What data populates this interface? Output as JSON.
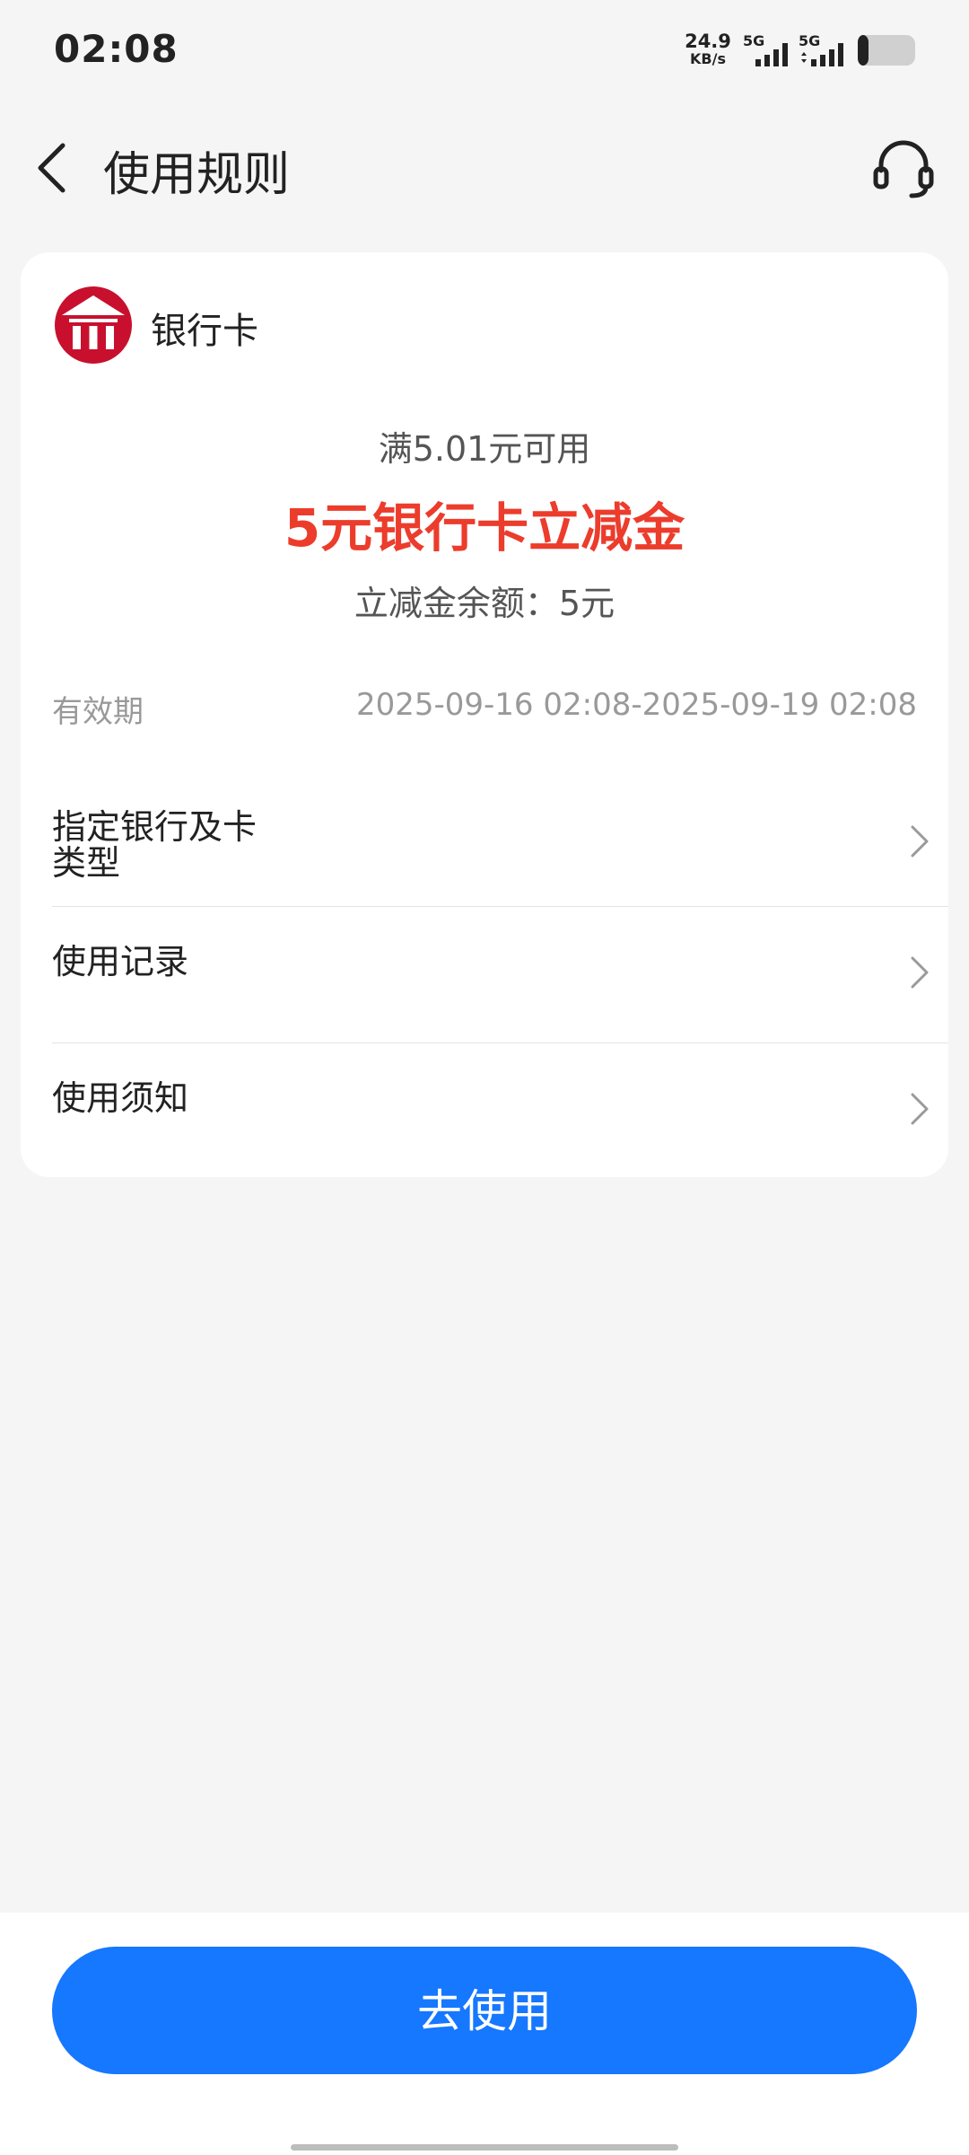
{
  "status_bar": {
    "time": "02:08",
    "net_speed_value": "24.9",
    "net_speed_unit": "KB/s",
    "sim1_label": "5G",
    "sim2_label": "5G",
    "battery_icon": "battery-icon"
  },
  "header": {
    "title": "使用规则",
    "back_icon": "back-arrow-icon",
    "service_icon": "headset-icon"
  },
  "card": {
    "bank_logo_icon": "bank-icon",
    "bank_name": "银行卡",
    "condition": "满5.01元可用",
    "coupon_title": "5元银行卡立减金",
    "balance": "立减金余额：5元",
    "validity_label": "有效期",
    "validity_value": "2025-09-16 02:08-2025-09-19 02:08",
    "menu": [
      {
        "line1": "指定银行及卡",
        "line2": "类型"
      },
      {
        "line1": "使用记录",
        "line2": ""
      },
      {
        "line1": "使用须知",
        "line2": ""
      }
    ]
  },
  "colors": {
    "accent_blue": "#1677ff",
    "coupon_red": "#ec3c2c",
    "bank_red": "#c8102e"
  },
  "bottom": {
    "use_button_label": "去使用"
  }
}
